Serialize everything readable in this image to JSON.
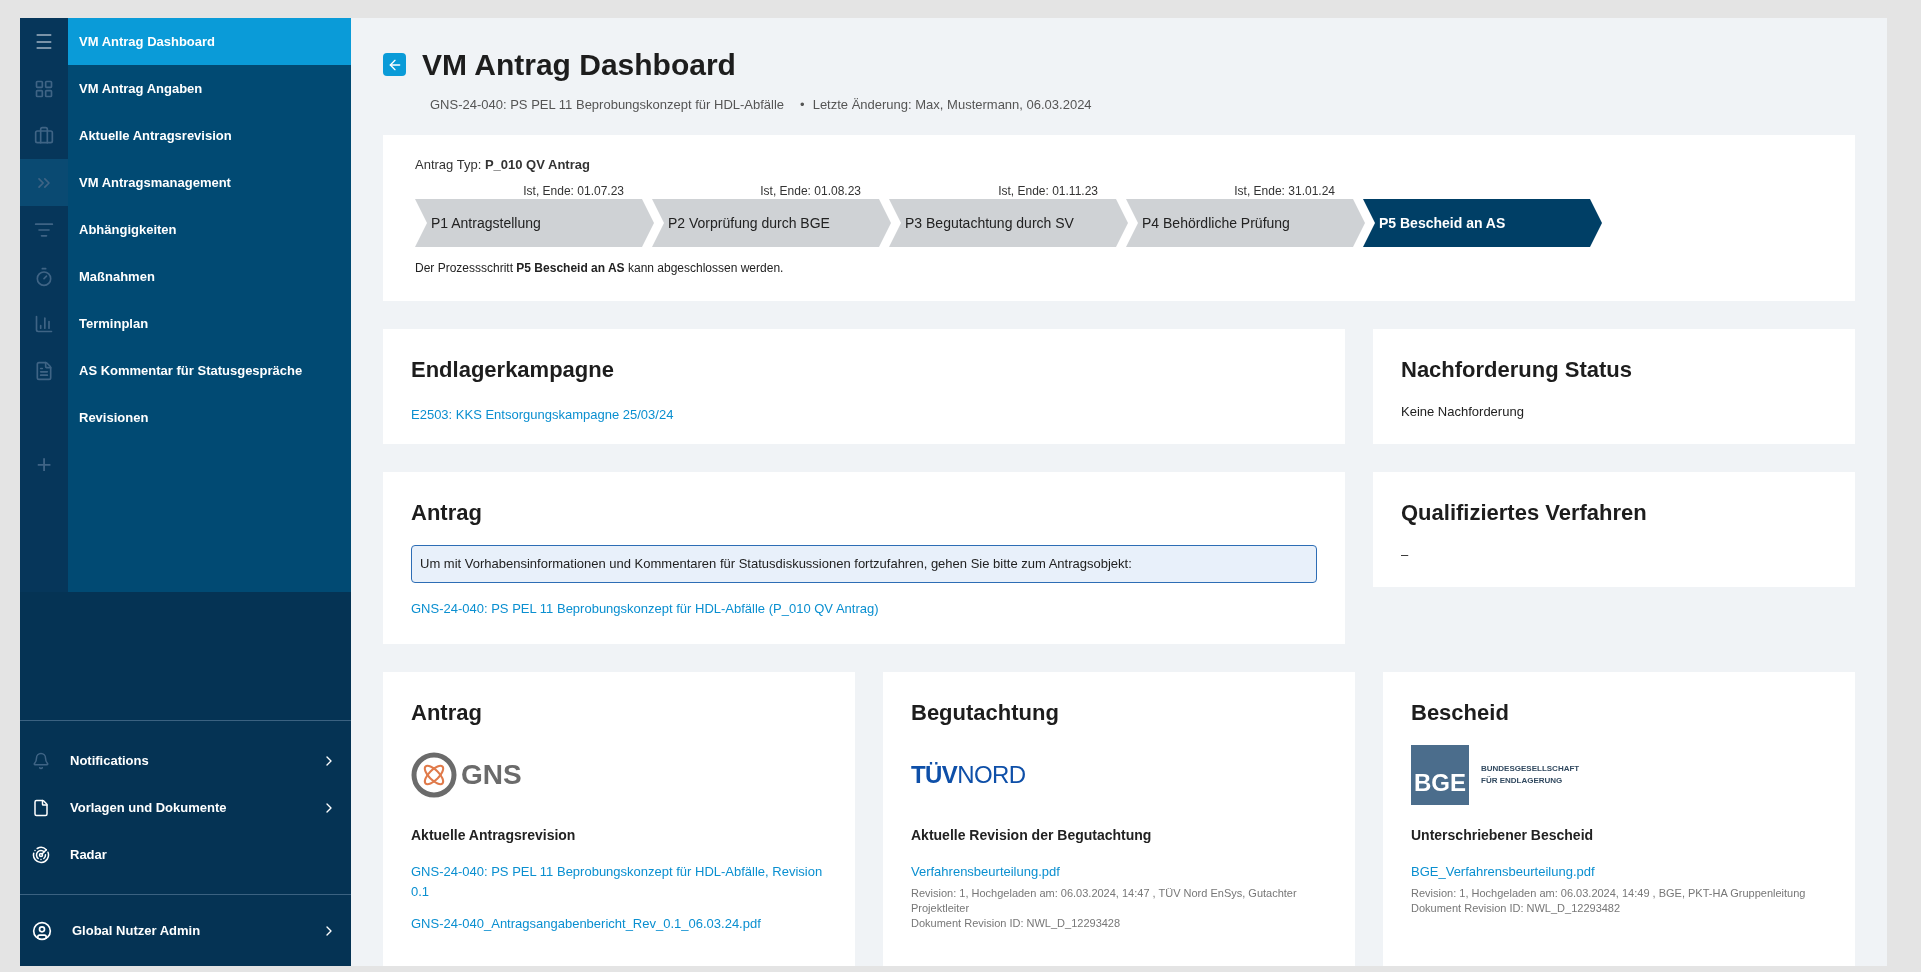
{
  "sidebar": {
    "menu_icon": "☰",
    "items": [
      {
        "label": "VM Antrag Dashboard",
        "selected": true,
        "rail_highlight": false
      },
      {
        "label": "VM Antrag Angaben",
        "selected": false,
        "rail_highlight": false
      },
      {
        "label": "Aktuelle Antragsrevision",
        "selected": false,
        "rail_highlight": false
      },
      {
        "label": "VM Antragsmanagement",
        "selected": false,
        "rail_highlight": true
      },
      {
        "label": "Abhängigkeiten",
        "selected": false,
        "rail_highlight": false
      },
      {
        "label": "Maßnahmen",
        "selected": false,
        "rail_highlight": false
      },
      {
        "label": "Terminplan",
        "selected": false,
        "rail_highlight": false
      },
      {
        "label": "AS Kommentar für Statusgespräche",
        "selected": false,
        "rail_highlight": false
      },
      {
        "label": "Revisionen",
        "selected": false,
        "rail_highlight": false
      }
    ],
    "add_icon": "+",
    "bottom_items": [
      {
        "label": "Notifications",
        "has_submenu": true
      },
      {
        "label": "Vorlagen und Dokumente",
        "has_submenu": true
      },
      {
        "label": "Radar",
        "has_submenu": false
      }
    ],
    "user": {
      "label": "Global Nutzer Admin",
      "has_submenu": true
    }
  },
  "header": {
    "title": "VM Antrag Dashboard",
    "subtitle": "GNS-24-040: PS PEL 11 Beprobungskonzept für HDL-Abfälle",
    "separator": "•",
    "last_change": "Letzte Änderung: Max, Mustermann, 06.03.2024"
  },
  "process": {
    "type_label": "Antrag Typ:",
    "type_value": "P_010 QV Antrag",
    "steps": [
      {
        "label": "P1 Antragstellung",
        "date": "Ist, Ende: 01.07.23",
        "current": false
      },
      {
        "label": "P2 Vorprüfung durch BGE",
        "date": "Ist, Ende: 01.08.23",
        "current": false
      },
      {
        "label": "P3 Begutachtung durch SV",
        "date": "Ist, Ende: 01.11.23",
        "current": false
      },
      {
        "label": "P4 Behördliche Prüfung",
        "date": "Ist, Ende: 31.01.24",
        "current": false
      },
      {
        "label": "P5 Bescheid an AS",
        "current": true
      }
    ],
    "note": "Der Prozessschritt **P5 Bescheid an AS** kann abgeschlossen werden."
  },
  "endlagerkampagne": {
    "title": "Endlagerkampagne",
    "link": "E2503: KKS Entsorgungskampagne 25/03/24"
  },
  "nachforderung_status": {
    "title": "Nachforderung Status",
    "value": "Keine Nachforderung"
  },
  "antrag": {
    "title": "Antrag",
    "info": "Um mit Vorhabensinformationen und Kommentaren für Statusdiskussionen fortzufahren, gehen Sie bitte zum Antragsobjekt:",
    "link": "GNS-24-040: PS PEL 11 Beprobungskonzept für HDL-Abfälle (P_010 QV Antrag)"
  },
  "qualifiziertes_verfahren": {
    "title": "Qualifiziertes Verfahren",
    "value": "–"
  },
  "documents": [
    {
      "title": "Antrag",
      "logo": {
        "kind": "gns",
        "text": "GNS"
      },
      "subtitle": "Aktuelle Antragsrevision",
      "links": [
        "GNS-24-040: PS PEL 11 Beprobungskonzept für HDL-Abfälle, Revision 0.1",
        "GNS-24-040_Antragsangabenbericht_Rev_0.1_06.03.24.pdf"
      ]
    },
    {
      "title": "Begutachtung",
      "logo": {
        "kind": "tuv",
        "text": "TÜV",
        "text2": "NORD"
      },
      "subtitle": "Aktuelle Revision der Begutachtung",
      "links": [
        "Verfahrensbeurteilung.pdf"
      ],
      "meta": [
        "Revision: 1, Hochgeladen am: 06.03.2024, 14:47 , TÜV Nord EnSys, Gutachter Projektleiter",
        "Dokument Revision ID: NWL_D_12293428"
      ]
    },
    {
      "title": "Bescheid",
      "logo": {
        "kind": "bge",
        "text": "BGE",
        "text2": "BUNDESGESELLSCHAFT",
        "text3": "FÜR ENDLAGERUNG"
      },
      "subtitle": "Unterschriebener Bescheid",
      "links": [
        "BGE_Verfahrensbeurteilung.pdf"
      ],
      "meta": [
        "Revision: 1, Hochgeladen am: 06.03.2024, 14:49 , BGE, PKT-HA Gruppenleitung",
        "Dokument Revision ID: NWL_D_12293482"
      ]
    }
  ]
}
